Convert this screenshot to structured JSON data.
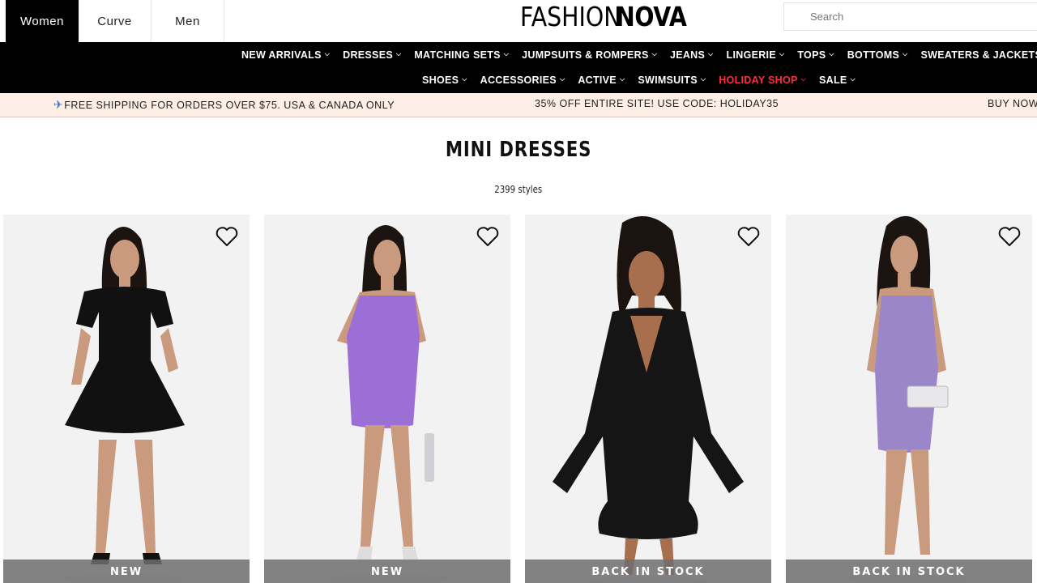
{
  "gender_tabs": [
    {
      "label": "Women",
      "active": true
    },
    {
      "label": "Curve",
      "active": false
    },
    {
      "label": "Men",
      "active": false
    }
  ],
  "logo": {
    "light": "FASHION",
    "bold": "NOVA"
  },
  "search": {
    "placeholder": "Search"
  },
  "nav": {
    "row1": [
      {
        "label": "NEW ARRIVALS"
      },
      {
        "label": "DRESSES"
      },
      {
        "label": "MATCHING SETS"
      },
      {
        "label": "JUMPSUITS & ROMPERS"
      },
      {
        "label": "JEANS"
      },
      {
        "label": "LINGERIE"
      },
      {
        "label": "TOPS"
      },
      {
        "label": "BOTTOMS"
      },
      {
        "label": "SWEATERS & JACKETS"
      }
    ],
    "row2": [
      {
        "label": "SHOES"
      },
      {
        "label": "ACCESSORIES"
      },
      {
        "label": "ACTIVE"
      },
      {
        "label": "SWIMSUITS"
      },
      {
        "label": "HOLIDAY SHOP",
        "highlight": true
      },
      {
        "label": "SALE"
      }
    ],
    "chevron_icon": "chevron-down-icon"
  },
  "promo": {
    "shipping": "FREE SHIPPING FOR ORDERS OVER $75. USA & CANADA ONLY",
    "discount": "35% OFF ENTIRE SITE! USE CODE: HOLIDAY35",
    "cta": "BUY NOW,"
  },
  "page": {
    "title": "MINI DRESSES",
    "count": "2399 styles"
  },
  "products": [
    {
      "badge": "NEW",
      "dress_color": "#111111"
    },
    {
      "badge": "NEW",
      "dress_color": "#9b6fd6"
    },
    {
      "badge": "BACK IN STOCK",
      "dress_color": "#151515"
    },
    {
      "badge": "BACK IN STOCK",
      "dress_color": "#9a86c9"
    }
  ],
  "colors": {
    "nav_bg": "#000000",
    "holiday": "#ff2d3b",
    "promo_bg": "#fdeee6"
  }
}
